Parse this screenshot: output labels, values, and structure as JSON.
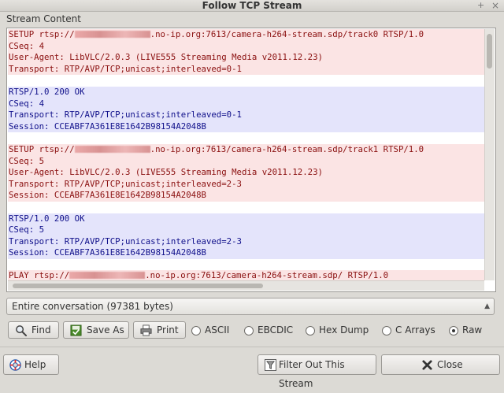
{
  "window": {
    "title": "Follow TCP Stream",
    "pin_glyph": "+",
    "close_glyph": "×"
  },
  "section_label": "Stream Content",
  "stream": {
    "lines": [
      {
        "dir": "c",
        "text": "SETUP rtsp://",
        "redacted": true,
        "after": ".no-ip.org:7613/camera-h264-stream.sdp/track0 RTSP/1.0"
      },
      {
        "dir": "c",
        "text": "CSeq: 4"
      },
      {
        "dir": "c",
        "text": "User-Agent: LibVLC/2.0.3 (LIVE555 Streaming Media v2011.12.23)"
      },
      {
        "dir": "c",
        "text": "Transport: RTP/AVP/TCP;unicast;interleaved=0-1"
      },
      {
        "dir": "blank",
        "text": ""
      },
      {
        "dir": "s",
        "text": "RTSP/1.0 200 OK"
      },
      {
        "dir": "s",
        "text": "CSeq: 4"
      },
      {
        "dir": "s",
        "text": "Transport: RTP/AVP/TCP;unicast;interleaved=0-1"
      },
      {
        "dir": "s",
        "text": "Session: CCEABF7A361E8E1642B98154A2048B"
      },
      {
        "dir": "blank",
        "text": ""
      },
      {
        "dir": "c",
        "text": "SETUP rtsp://",
        "redacted": true,
        "after": ".no-ip.org:7613/camera-h264-stream.sdp/track1 RTSP/1.0"
      },
      {
        "dir": "c",
        "text": "CSeq: 5"
      },
      {
        "dir": "c",
        "text": "User-Agent: LibVLC/2.0.3 (LIVE555 Streaming Media v2011.12.23)"
      },
      {
        "dir": "c",
        "text": "Transport: RTP/AVP/TCP;unicast;interleaved=2-3"
      },
      {
        "dir": "c",
        "text": "Session: CCEABF7A361E8E1642B98154A2048B"
      },
      {
        "dir": "blank",
        "text": ""
      },
      {
        "dir": "s",
        "text": "RTSP/1.0 200 OK"
      },
      {
        "dir": "s",
        "text": "CSeq: 5"
      },
      {
        "dir": "s",
        "text": "Transport: RTP/AVP/TCP;unicast;interleaved=2-3"
      },
      {
        "dir": "s",
        "text": "Session: CCEABF7A361E8E1642B98154A2048B"
      },
      {
        "dir": "blank",
        "text": ""
      },
      {
        "dir": "c",
        "text": "PLAY rtsp://",
        "redacted": true,
        "after": ".no-ip.org:7613/camera-h264-stream.sdp/ RTSP/1.0"
      }
    ],
    "colors": {
      "client_bg": "#fbe4e4",
      "client_fg": "#8a0f0f",
      "server_bg": "#e4e4fb",
      "server_fg": "#0f0f8a"
    }
  },
  "conversation_select": {
    "value": "Entire conversation (97381 bytes)"
  },
  "toolbar": {
    "find": {
      "label": "Find",
      "icon": "magnifier-icon"
    },
    "save_as": {
      "label": "Save As",
      "icon": "save-icon"
    },
    "print": {
      "label": "Print",
      "icon": "printer-icon"
    }
  },
  "format": {
    "options": [
      "ASCII",
      "EBCDIC",
      "Hex Dump",
      "C Arrays",
      "Raw"
    ],
    "selected": "Raw"
  },
  "footer": {
    "help": {
      "label": "Help",
      "icon": "help-lifebuoy-icon"
    },
    "filter": {
      "label": "Filter Out This Stream",
      "icon": "filter-icon"
    },
    "close": {
      "label": "Close",
      "icon": "close-x-icon"
    }
  }
}
